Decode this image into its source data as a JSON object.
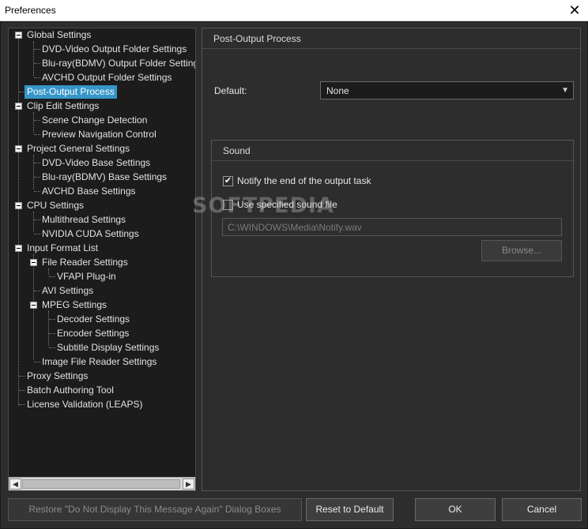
{
  "window": {
    "title": "Preferences"
  },
  "tree": {
    "items": [
      {
        "label": "Global Settings"
      },
      {
        "label": "DVD-Video Output Folder Settings"
      },
      {
        "label": "Blu-ray(BDMV) Output Folder Settings"
      },
      {
        "label": "AVCHD Output Folder Settings"
      },
      {
        "label": "Post-Output Process"
      },
      {
        "label": "Clip Edit Settings"
      },
      {
        "label": "Scene Change Detection"
      },
      {
        "label": "Preview Navigation Control"
      },
      {
        "label": "Project General Settings"
      },
      {
        "label": "DVD-Video Base Settings"
      },
      {
        "label": "Blu-ray(BDMV) Base Settings"
      },
      {
        "label": "AVCHD Base Settings"
      },
      {
        "label": "CPU Settings"
      },
      {
        "label": "Multithread Settings"
      },
      {
        "label": "NVIDIA CUDA Settings"
      },
      {
        "label": "Input Format List"
      },
      {
        "label": "File Reader Settings"
      },
      {
        "label": "VFAPI Plug-in"
      },
      {
        "label": "AVI Settings"
      },
      {
        "label": "MPEG Settings"
      },
      {
        "label": "Decoder Settings"
      },
      {
        "label": "Encoder Settings"
      },
      {
        "label": "Subtitle Display Settings"
      },
      {
        "label": "Image File Reader Settings"
      },
      {
        "label": "Proxy Settings"
      },
      {
        "label": "Batch Authoring Tool"
      },
      {
        "label": "License Validation (LEAPS)"
      }
    ]
  },
  "panel": {
    "title": "Post-Output Process",
    "default_label": "Default:",
    "default_value": "None",
    "sound": {
      "title": "Sound",
      "notify_label": "Notify the end of the output task",
      "notify_checked": true,
      "use_sound_label": "Use specified sound file",
      "use_sound_checked": false,
      "sound_path": "C:\\WINDOWS\\Media\\Notify.wav",
      "browse_label": "Browse..."
    }
  },
  "watermark": "SOFTPEDIA",
  "buttons": {
    "restore": "Restore \"Do Not Display This Message Again\" Dialog Boxes",
    "reset": "Reset to Default",
    "ok": "OK",
    "cancel": "Cancel"
  },
  "colors": {
    "selection": "#3596c8",
    "background": "#2d2d2d"
  }
}
